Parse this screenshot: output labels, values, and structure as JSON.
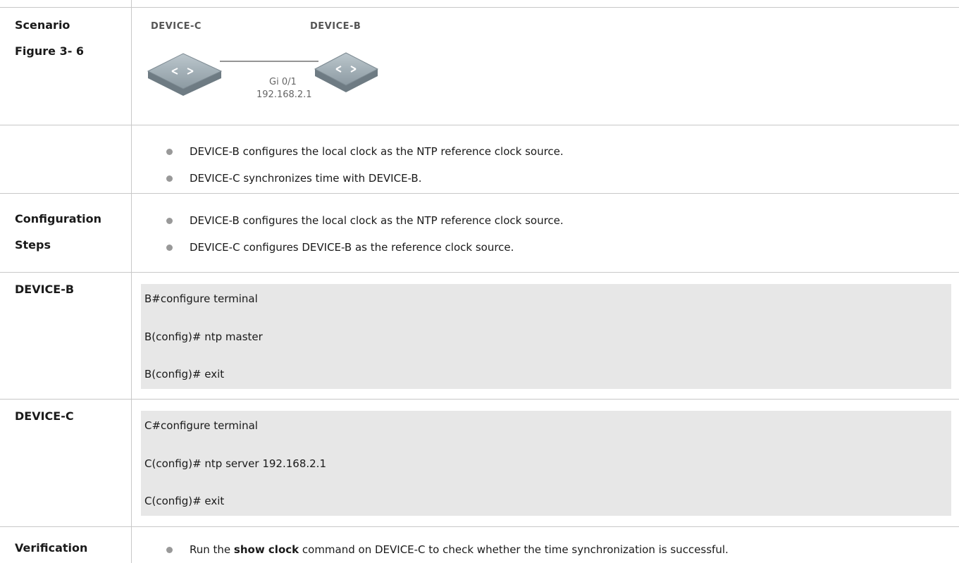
{
  "rows": {
    "scenario": {
      "label1": "Scenario",
      "label2": "Figure 3- 6",
      "device_c": "DEVICE-C",
      "device_b": "DEVICE-B",
      "port": "Gi 0/1",
      "ip": "192.168.2.1"
    },
    "description": {
      "bullets": [
        "DEVICE-B configures the local clock as the NTP reference clock source.",
        "DEVICE-C synchronizes time with DEVICE-B."
      ]
    },
    "config_steps": {
      "label1": "Configuration",
      "label2": "Steps",
      "bullets": [
        "DEVICE-B configures the local clock as the NTP reference clock source.",
        "DEVICE-C configures DEVICE-B as the reference clock source."
      ]
    },
    "device_b": {
      "label": "DEVICE-B",
      "commands": [
        "B#configure terminal",
        "B(config)# ntp master",
        "B(config)# exit"
      ]
    },
    "device_c": {
      "label": "DEVICE-C",
      "commands": [
        "C#configure terminal",
        "C(config)# ntp server 192.168.2.1",
        "C(config)# exit"
      ]
    },
    "verification": {
      "label": "Verification",
      "prefix": "Run the ",
      "bold": "show clock",
      "suffix": " command on DEVICE-C to check whether the time synchronization is successful."
    }
  }
}
